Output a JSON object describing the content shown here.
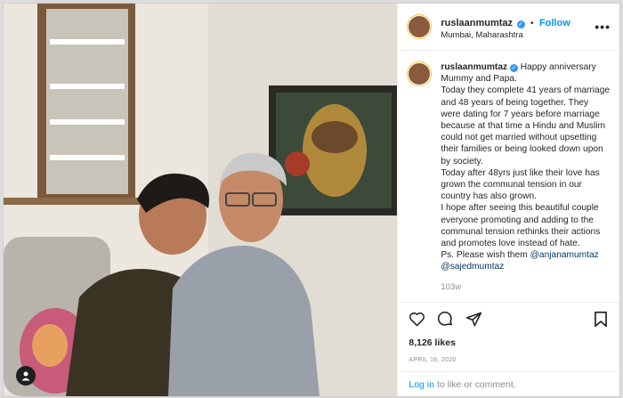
{
  "post": {
    "username": "ruslaanmumtaz",
    "follow_label": "Follow",
    "location": "Mumbai, Maharashtra",
    "more_label": "•••",
    "caption": {
      "lines": [
        "Today they complete 41 years of marriage and 48 years of being together. They were dating for 7 years before marriage because at that time a Hindu and Muslim could not get married without upsetting their families or being looked down upon by society.",
        "Today after 48yrs just like their love has grown the communal tension in our country has also grown.",
        "I hope after seeing this beautiful couple everyone promoting and adding to the communal tension rethinks their actions and promotes love instead of hate."
      ],
      "first_line": "Happy anniversary Mummy and Papa.",
      "ps_text": "Ps. Please wish them",
      "mention1": "@anjanamumtaz",
      "mention2": "@sajedmumtaz"
    },
    "age": "103w",
    "likes": "8,126 likes",
    "date": "APRIL 16, 2020",
    "login_link": "Log in",
    "login_rest": "to like or comment."
  },
  "icons": {
    "verified": "verified-badge-icon",
    "heart": "heart-icon",
    "comment": "comment-icon",
    "share": "share-icon",
    "save": "bookmark-icon",
    "user_tag": "user-tag-icon"
  },
  "colors": {
    "accent": "#0095f6",
    "verified": "#3897f0",
    "muted": "#8e8e8e",
    "text": "#262626"
  }
}
